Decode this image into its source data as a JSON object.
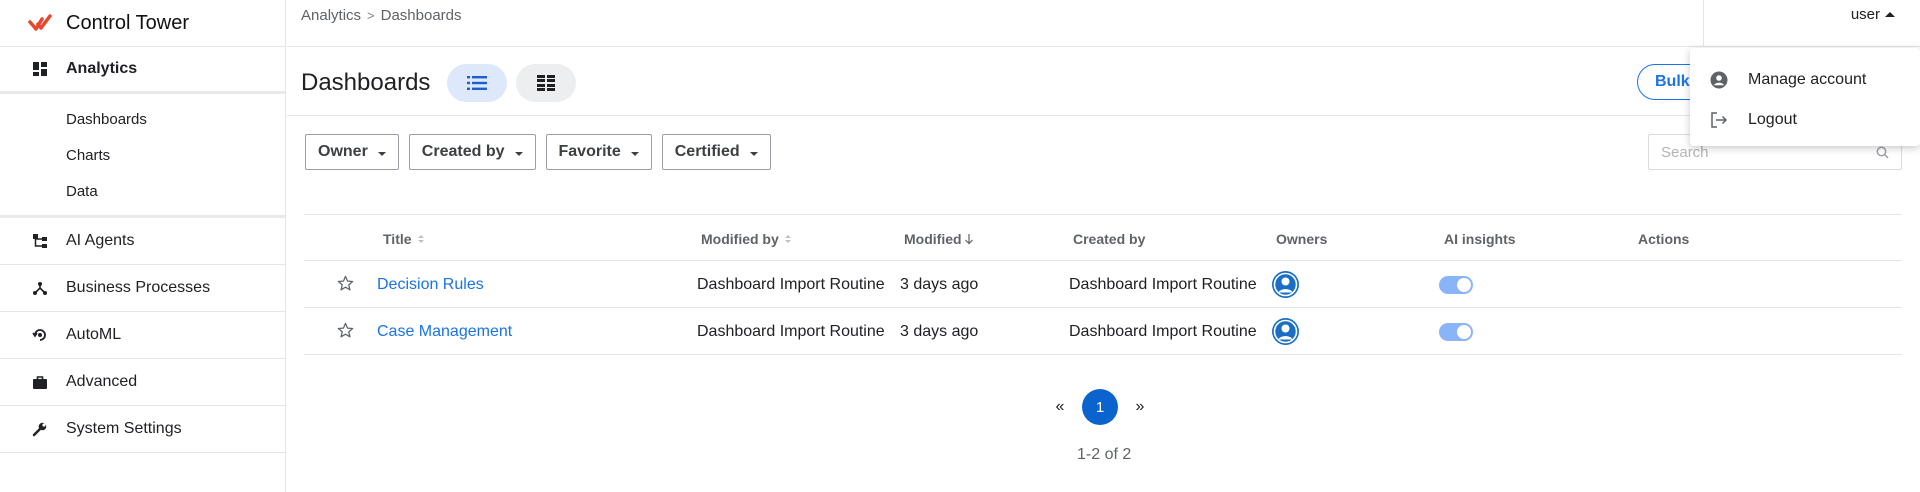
{
  "brand": {
    "name": "Control Tower",
    "accent_color": "#e8482c"
  },
  "sidebar": {
    "analytics": {
      "label": "Analytics",
      "icon": "dashboard-icon"
    },
    "analytics_items": [
      {
        "label": "Dashboards"
      },
      {
        "label": "Charts"
      },
      {
        "label": "Data"
      }
    ],
    "items": [
      {
        "label": "AI Agents",
        "icon": "hierarchy-icon"
      },
      {
        "label": "Business Processes",
        "icon": "process-icon"
      },
      {
        "label": "AutoML",
        "icon": "automl-icon"
      },
      {
        "label": "Advanced",
        "icon": "briefcase-icon"
      },
      {
        "label": "System Settings",
        "icon": "wrench-icon"
      }
    ]
  },
  "header": {
    "breadcrumb": [
      "Analytics",
      "Dashboards"
    ],
    "user_label": "user"
  },
  "page": {
    "title": "Dashboards",
    "bulk_label": "Bulk",
    "view_modes": [
      "list",
      "grid"
    ],
    "active_view": "list"
  },
  "filters": [
    "Owner",
    "Created by",
    "Favorite",
    "Certified"
  ],
  "search": {
    "placeholder": "Search",
    "value": ""
  },
  "table": {
    "columns": [
      "Title",
      "Modified by",
      "Modified",
      "Created by",
      "Owners",
      "AI insights",
      "Actions"
    ],
    "rows": [
      {
        "title": "Decision Rules",
        "modified_by": "Dashboard Import Routine",
        "modified": "3 days ago",
        "created_by": "Dashboard Import Routine",
        "ai_insights": true
      },
      {
        "title": "Case Management",
        "modified_by": "Dashboard Import Routine",
        "modified": "3 days ago",
        "created_by": "Dashboard Import Routine",
        "ai_insights": true
      }
    ]
  },
  "pagination": {
    "prev": "«",
    "current": "1",
    "next": "»",
    "summary": "1-2 of 2"
  },
  "user_menu": [
    {
      "label": "Manage account",
      "icon": "account-circle-icon"
    },
    {
      "label": "Logout",
      "icon": "logout-icon"
    }
  ],
  "colors": {
    "link": "#1a73e8",
    "primary": "#0b63ce",
    "toggle_on": "#8ab4f8"
  }
}
